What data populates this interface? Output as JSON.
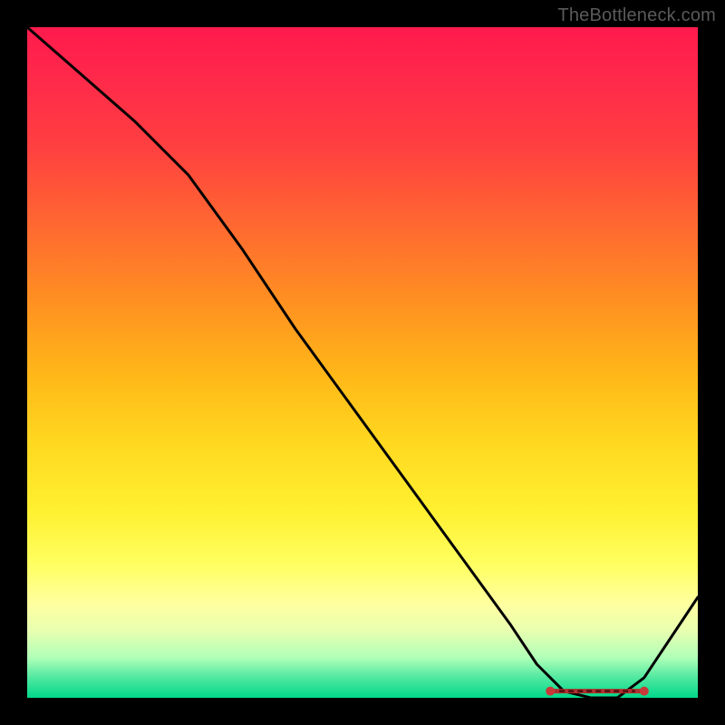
{
  "attribution": "TheBottleneck.com",
  "chart_data": {
    "type": "line",
    "title": "",
    "xlabel": "",
    "ylabel": "",
    "ylim": [
      0,
      100
    ],
    "xlim": [
      0,
      100
    ],
    "x": [
      0,
      8,
      16,
      24,
      32,
      40,
      48,
      56,
      64,
      72,
      76,
      80,
      84,
      88,
      92,
      100
    ],
    "values": [
      100,
      93,
      86,
      78,
      67,
      55,
      44,
      33,
      22,
      11,
      5,
      1,
      0,
      0,
      3,
      15
    ],
    "optimum_band": {
      "x_start": 78,
      "x_end": 92,
      "y": 1
    },
    "gradient_stops": [
      {
        "pos": 0.0,
        "color": "#ff1a4d"
      },
      {
        "pos": 0.18,
        "color": "#ff4040"
      },
      {
        "pos": 0.42,
        "color": "#ff9420"
      },
      {
        "pos": 0.62,
        "color": "#ffd820"
      },
      {
        "pos": 0.8,
        "color": "#ffff60"
      },
      {
        "pos": 0.94,
        "color": "#b0ffb8"
      },
      {
        "pos": 1.0,
        "color": "#00d88a"
      }
    ]
  }
}
